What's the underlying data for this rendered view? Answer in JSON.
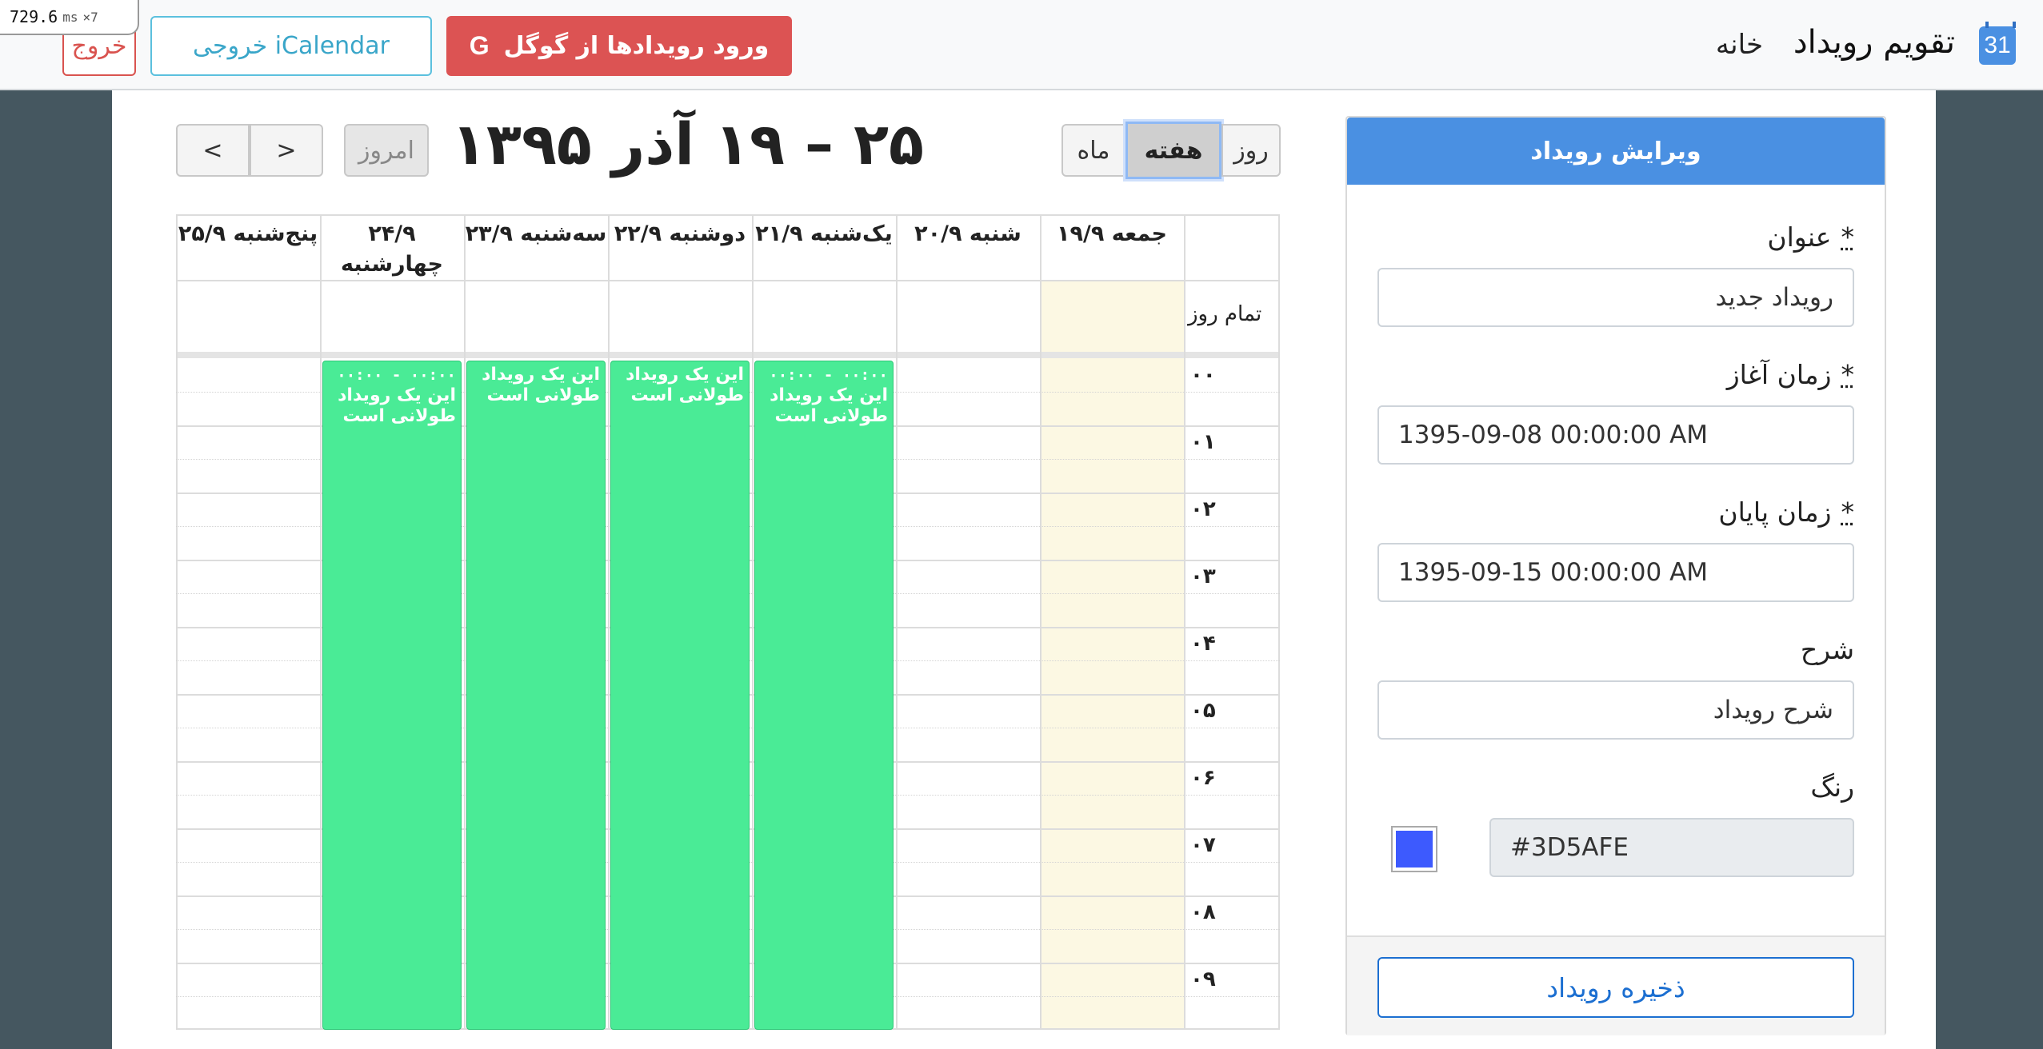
{
  "overlay": {
    "timing": "729.6",
    "unit": "ms",
    "multiplier": "×7"
  },
  "navbar": {
    "brand_icon": "31",
    "brand_text": "تقویم رویداد",
    "home": "خانه",
    "google_import": "ورود رویدادها از گوگل",
    "google_icon": "G",
    "ical_export": "خروجی iCalendar",
    "logout": "خروج"
  },
  "calendar": {
    "title": "۲۵ – ۱۹ آذر ۱۳۹۵",
    "nav_prev_icon": "chevron-left-icon",
    "nav_next_icon": "chevron-right-icon",
    "prev_glyph": "<",
    "next_glyph": ">",
    "today": "امروز",
    "views": {
      "month": "ماه",
      "week": "هفته",
      "day": "روز"
    },
    "active_view": "week",
    "all_day": "تمام روز",
    "days": [
      {
        "label": "جمعه ۱۹/۹",
        "today": true
      },
      {
        "label": "شنبه ۲۰/۹"
      },
      {
        "label": "یک‌شنبه ۲۱/۹"
      },
      {
        "label": "دوشنبه ۲۲/۹"
      },
      {
        "label": "سه‌شنبه ۲۳/۹"
      },
      {
        "label": "۲۴/۹ چهارشنبه"
      },
      {
        "label": "پنج‌شنبه ۲۵/۹"
      }
    ],
    "hours": [
      "۰۰",
      "۰۱",
      "۰۲",
      "۰۳",
      "۰۴",
      "۰۵",
      "۰۶",
      "۰۷",
      "۰۸",
      "۰۹"
    ],
    "events": [
      {
        "time": "۰۰:۰۰ - ۰۰:۰۰",
        "title": "این یک رویداد طولانی است"
      },
      {
        "time": "",
        "title": "این یک رویداد طولانی است"
      },
      {
        "time": "",
        "title": "این یک رویداد طولانی است"
      },
      {
        "time": "۰۰:۰۰ - ۰۰:۰۰",
        "title": "این یک رویداد طولانی است"
      }
    ],
    "event_color": "#4AEB96",
    "today_color": "#FCF8E3"
  },
  "edit_panel": {
    "title": "ویرایش رویداد",
    "required_mark": "*",
    "fields": {
      "title_label": "عنوان",
      "title_value": "رویداد جدید",
      "start_label": "زمان آغاز",
      "start_value": "1395-09-08 00:00:00 AM",
      "end_label": "زمان پایان",
      "end_value": "1395-09-15 00:00:00 AM",
      "desc_label": "شرح",
      "desc_value": "شرح رویداد",
      "color_label": "رنگ",
      "color_value": "#3D5AFE"
    },
    "save": "ذخیره رویداد",
    "header_color": "#4A90E2"
  },
  "theme": {
    "sidebar_color": "#455760",
    "danger": "#DC5353",
    "info": "#5BC0DE",
    "primary": "#1C6FD1"
  }
}
